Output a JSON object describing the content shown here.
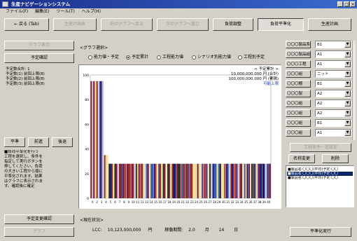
{
  "window": {
    "title": "生産ナビゲーションシステム",
    "minimize_label": "_",
    "maximize_label": "□",
    "close_label": "×"
  },
  "menu": [
    "ファイル(F)",
    "編集(E)",
    "ツール(T)",
    "ヘルプ(H)"
  ],
  "toolbar": [
    {
      "label": "← 戻る (Tab)",
      "enabled": true,
      "pressed": false
    },
    {
      "label": "生産計画表",
      "enabled": false,
      "pressed": false
    },
    {
      "label": "前のグラフへ戻る",
      "enabled": false,
      "pressed": false
    },
    {
      "label": "次のグラフへ進む",
      "enabled": false,
      "pressed": false
    },
    {
      "label": "負荷調整",
      "enabled": true,
      "pressed": false
    },
    {
      "label": "負荷平準化",
      "enabled": true,
      "pressed": true
    },
    {
      "label": "生産計画",
      "enabled": true,
      "pressed": false
    }
  ],
  "left_panel": {
    "top_button": "グラフ表示",
    "plan_button": "予定確認",
    "info_lines": [
      "予定数合計: 1",
      "予定数(1) 前回上限(8)",
      "予定数(2) 前回上限(8)",
      "予定数(3) 前回上限(8)"
    ],
    "small_buttons": [
      "平準",
      "前進",
      "後退"
    ],
    "note_lines": [
      "■負荷平準化を行う",
      "工程を選択し、条件を",
      "指定して実行ボタンを",
      "押してください。負荷",
      "の大きい工程から順に",
      "平準化されます。結果",
      "はグラフに表示されま",
      "す。確認後に確定"
    ],
    "bottom_button_1": "予定変更確認",
    "bottom_button_2": "グラフ"
  },
  "graph": {
    "section_label": "<グラフ選択>",
    "radio_options": [
      {
        "label": "能力値・予定",
        "selected": false
      },
      {
        "label": "予定累計",
        "selected": true
      },
      {
        "label": "工程能力値",
        "selected": false
      },
      {
        "label": "シナリオ別能力値",
        "selected": false
      },
      {
        "label": "工程別予定",
        "selected": false
      }
    ],
    "legend": {
      "title": "< 予定累計 >",
      "line1": "10,000,000.000 円 (合計)",
      "line2": "100,000,000.000 円 (累積)",
      "line3": "可能上限"
    }
  },
  "chart_data": {
    "type": "bar",
    "title": "",
    "xlabel": "",
    "ylabel": "",
    "ylim": [
      0,
      100
    ],
    "y_ticks": [
      "100",
      "80",
      "60",
      "40",
      "20",
      "0"
    ],
    "categories": [
      "0",
      "2",
      "3",
      "4",
      "5",
      "6",
      "7",
      "8",
      "9",
      "10",
      "11",
      "12",
      "13",
      "14",
      "15",
      "16",
      "17",
      "18",
      "19",
      "20",
      "21",
      "22",
      "23",
      "24",
      "25",
      "26",
      "27",
      "28",
      "29",
      "30",
      "31",
      "32",
      "33",
      "34",
      "35",
      "36",
      "37",
      "38",
      "39",
      "40"
    ],
    "values": [
      95,
      95,
      95,
      35,
      28,
      28,
      28,
      28,
      28,
      28,
      28,
      28,
      28,
      28,
      28,
      28,
      28,
      28,
      28,
      28,
      28,
      28,
      28,
      28,
      28,
      28,
      28,
      28,
      28,
      28,
      28,
      28,
      28,
      28,
      28,
      28,
      28,
      28,
      28,
      28
    ],
    "stack_colors": [
      "#1a1a6e",
      "#7a1f3d",
      "#e8d88a",
      "#3b5fae",
      "#8c2a2a",
      "#c9c9e8",
      "#2d2d2d",
      "#f2e6b8",
      "#5a4a8c",
      "#b34040"
    ],
    "grid": false,
    "legend": "top-right"
  },
  "right_panel": {
    "rows": [
      {
        "label": "〇〇〇製品系",
        "value": "B1"
      },
      {
        "label": "〇〇〇製品組",
        "value": "A1"
      },
      {
        "label": "〇〇〇工程",
        "value": "A1"
      },
      {
        "label": "〇〇〇組",
        "value": "ニット"
      },
      {
        "label": "〇〇〇棚",
        "value": "B1"
      },
      {
        "label": "〇〇〇製",
        "value": "A2"
      },
      {
        "label": "〇〇〇組",
        "value": "A2"
      },
      {
        "label": "〇〇〇組",
        "value": "A2"
      },
      {
        "label": "〇〇〇組",
        "value": "B1"
      },
      {
        "label": "〇〇〇組",
        "value": "A1"
      }
    ],
    "long_button": "工程条件一括設定",
    "btn_change": "名称変更",
    "btn_delete": "削除",
    "list_items": [
      {
        "text": "■製品名:〇〇〇(平均)予定:〇〇",
        "selected": false
      },
      {
        "text": "■製品名:〇〇〇(平均)予定:〇〇",
        "selected": true
      },
      {
        "text": "■製品名:〇〇〇(平均)予定:〇〇",
        "selected": false
      }
    ],
    "exec_button": "平準化実行"
  },
  "status": {
    "section_label": "<現在状況>",
    "lcc_label": "LCC:",
    "lcc_value": "10,123,000,000",
    "lcc_unit": "円",
    "period_label": "稼働期間:",
    "period_value1": "2.0",
    "period_unit1": "月",
    "period_value2": "14",
    "period_unit2": "日"
  }
}
